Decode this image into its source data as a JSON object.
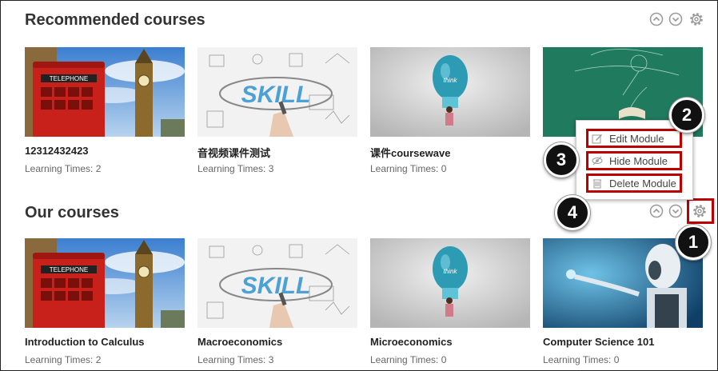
{
  "recommended": {
    "title": "Recommended courses",
    "courses": [
      {
        "title": "12312432423",
        "meta": "Learning Times: 2",
        "image": "london-phone-booth"
      },
      {
        "title": "音视频课件测试",
        "meta": "Learning Times: 3",
        "image": "skill-sketch"
      },
      {
        "title": "课件coursewave",
        "meta": "Learning Times: 0",
        "image": "lightbulb-think"
      },
      {
        "title": "",
        "meta": "",
        "image": "chalkboard-book"
      }
    ]
  },
  "our": {
    "title": "Our courses",
    "courses": [
      {
        "title": "Introduction to Calculus",
        "meta": "Learning Times: 2",
        "image": "london-phone-booth"
      },
      {
        "title": "Macroeconomics",
        "meta": "Learning Times: 3",
        "image": "skill-sketch"
      },
      {
        "title": "Microeconomics",
        "meta": "Learning Times: 0",
        "image": "lightbulb-think"
      },
      {
        "title": "Computer Science 101",
        "meta": "Learning Times: 0",
        "image": "robot-ai"
      }
    ]
  },
  "menu": {
    "edit": "Edit Module",
    "hide": "Hide Module",
    "delete": "Delete Module"
  },
  "callouts": {
    "one": "1",
    "two": "2",
    "three": "3",
    "four": "4"
  },
  "thumb_text": {
    "telephone": "TELEPHONE",
    "skill": "SKILL",
    "think": "think"
  },
  "colors": {
    "highlight": "#b00000",
    "callout": "#111111"
  }
}
